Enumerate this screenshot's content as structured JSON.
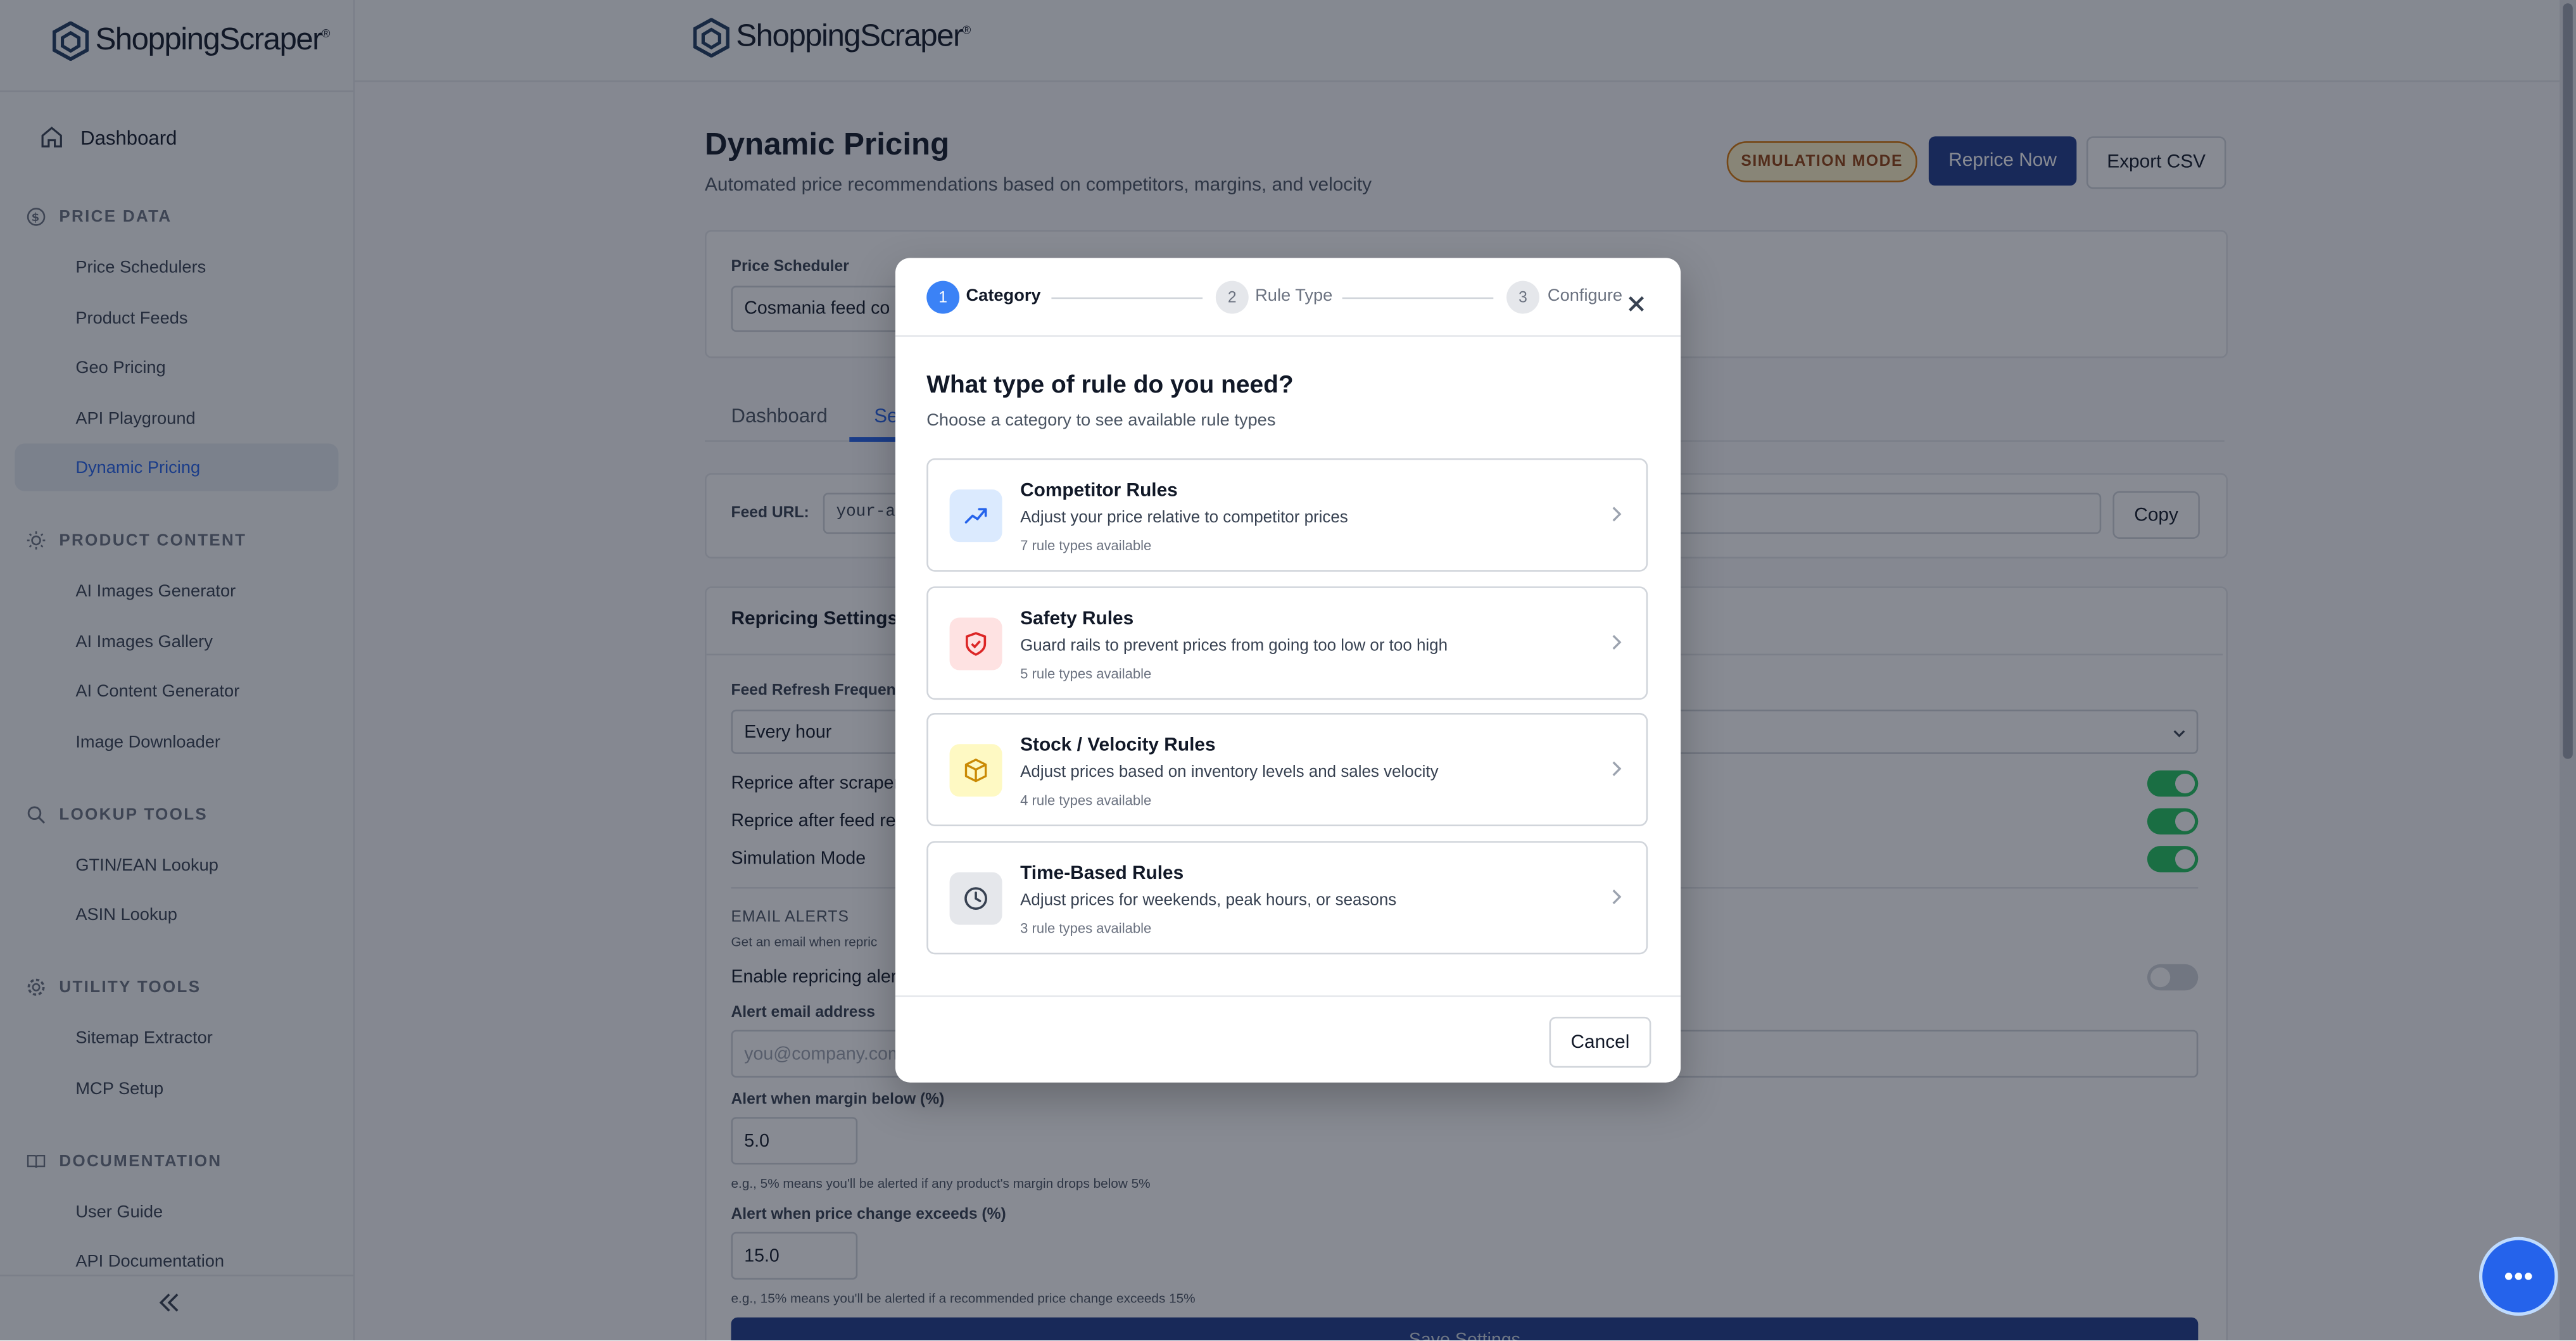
{
  "brand": {
    "name": "ShoppingScraper",
    "mark": "®"
  },
  "sidebar": {
    "dashboard": "Dashboard",
    "sections": [
      {
        "title": "PRICE DATA",
        "items": [
          "Price Schedulers",
          "Product Feeds",
          "Geo Pricing",
          "API Playground",
          "Dynamic Pricing"
        ]
      },
      {
        "title": "PRODUCT CONTENT",
        "items": [
          "AI Images Generator",
          "AI Images Gallery",
          "AI Content Generator",
          "Image Downloader"
        ]
      },
      {
        "title": "LOOKUP TOOLS",
        "items": [
          "GTIN/EAN Lookup",
          "ASIN Lookup"
        ]
      },
      {
        "title": "UTILITY TOOLS",
        "items": [
          "Sitemap Extractor",
          "MCP Setup"
        ]
      },
      {
        "title": "DOCUMENTATION",
        "items": [
          "User Guide",
          "API Documentation"
        ]
      }
    ],
    "active_item": "Dynamic Pricing"
  },
  "header": {
    "title": "Dynamic Pricing",
    "subtitle": "Automated price recommendations based on competitors, margins, and velocity",
    "badge": "SIMULATION MODE",
    "reprice_button": "Reprice Now",
    "export_button": "Export CSV"
  },
  "scheduler": {
    "label": "Price Scheduler",
    "value": "Cosmania feed co"
  },
  "tabs": [
    "Dashboard",
    "Se"
  ],
  "feed": {
    "label": "Feed URL:",
    "value": "your-ap",
    "copy_button": "Copy"
  },
  "settings": {
    "title": "Repricing Settings",
    "refresh_label": "Feed Refresh Frequen",
    "refresh_value": "Every hour",
    "toggles": [
      "Reprice after scraper",
      "Reprice after feed refr",
      "Simulation Mode"
    ],
    "email_title": "EMAIL ALERTS",
    "email_desc": "Get an email when repric",
    "enable_alerts": "Enable repricing alerts",
    "alert_email_label": "Alert email address",
    "alert_email_placeholder": "you@company.com",
    "margin_label": "Alert when margin below (%)",
    "margin_value": "5.0",
    "margin_help": "e.g., 5% means you'll be alerted if any product's margin drops below 5%",
    "price_label": "Alert when price change exceeds (%)",
    "price_value": "15.0",
    "price_help": "e.g., 15% means you'll be alerted if a recommended price change exceeds 15%",
    "save_button": "Save Settings"
  },
  "modal": {
    "steps": [
      {
        "num": "1",
        "label": "Category"
      },
      {
        "num": "2",
        "label": "Rule Type"
      },
      {
        "num": "3",
        "label": "Configure"
      }
    ],
    "title": "What type of rule do you need?",
    "subtitle": "Choose a category to see available rule types",
    "categories": [
      {
        "name": "Competitor Rules",
        "desc": "Adjust your price relative to competitor prices",
        "count": "7 rule types available",
        "icon": "trending-up-icon",
        "bg": "#dbeafe",
        "fg": "#2563eb"
      },
      {
        "name": "Safety Rules",
        "desc": "Guard rails to prevent prices from going too low or too high",
        "count": "5 rule types available",
        "icon": "shield-icon",
        "bg": "#fee2e2",
        "fg": "#dc2626"
      },
      {
        "name": "Stock / Velocity Rules",
        "desc": "Adjust prices based on inventory levels and sales velocity",
        "count": "4 rule types available",
        "icon": "box-icon",
        "bg": "#fef9c3",
        "fg": "#ca8a04"
      },
      {
        "name": "Time-Based Rules",
        "desc": "Adjust prices for weekends, peak hours, or seasons",
        "count": "3 rule types available",
        "icon": "clock-icon",
        "bg": "#e5e7eb",
        "fg": "#374151"
      }
    ],
    "cancel_button": "Cancel"
  }
}
